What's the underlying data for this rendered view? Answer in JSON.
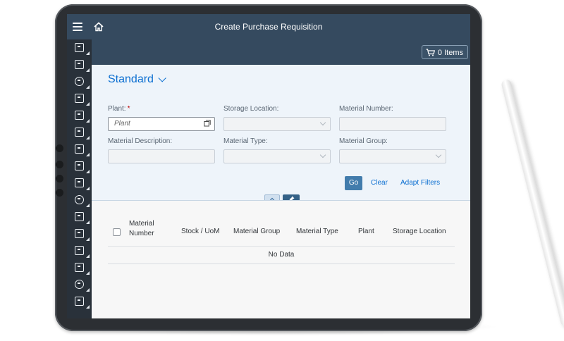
{
  "shell": {
    "title": "Create Purchase Requisition",
    "menu_icon": "hamburger-menu-icon",
    "home_icon": "home-icon"
  },
  "rail": {
    "icons": [
      "id-card-icon",
      "package-icon",
      "location-icon",
      "stamp-icon",
      "tools-icon",
      "goods-receipt-icon",
      "document-icon",
      "money-document-icon",
      "clipboard-icon",
      "checkmark-circle-icon",
      "invoice-icon",
      "notebook-icon",
      "truck-icon",
      "package-icon",
      "location-icon",
      "inbox-icon"
    ]
  },
  "toolbar": {
    "cart_label": "0 Items",
    "cart_icon": "cart-icon"
  },
  "filters": {
    "variant_label": "Standard",
    "fields": [
      {
        "label": "Plant:",
        "required_mark": "*",
        "placeholder": "Plant"
      },
      {
        "label": "Storage Location:"
      },
      {
        "label": "Material Number:"
      },
      {
        "label": "Material Description:"
      },
      {
        "label": "Material Type:"
      },
      {
        "label": "Material Group:"
      }
    ],
    "go_label": "Go",
    "clear_label": "Clear",
    "adapt_label": "Adapt Filters"
  },
  "table": {
    "columns": [
      "Material Number",
      "Stock / UoM",
      "Material Group",
      "Material Type",
      "Plant",
      "Storage Location"
    ],
    "empty_text": "No Data"
  },
  "colors": {
    "shell": "#354a5f",
    "rail": "#29313a",
    "accent": "#0a6ed1",
    "go_button": "#427cac",
    "filterbar": "#eef4fa"
  }
}
